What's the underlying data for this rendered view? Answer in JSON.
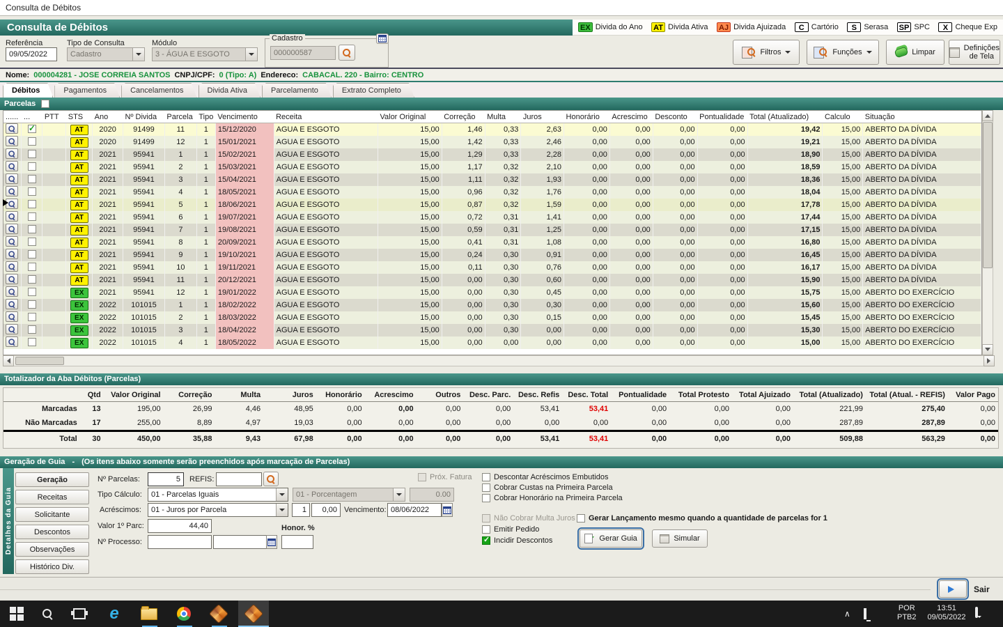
{
  "window": {
    "title": "Consulta de Débitos"
  },
  "header": {
    "title": "Consulta de Débitos",
    "legend": [
      {
        "badge": "EX",
        "type": "green",
        "label": "Divida do Ano"
      },
      {
        "badge": "AT",
        "type": "yellow",
        "label": "Divida Ativa"
      },
      {
        "badge": "AJ",
        "type": "orange",
        "label": "Divida Ajuizada"
      },
      {
        "badge": "C",
        "type": "plain",
        "label": "Cartório"
      },
      {
        "badge": "S",
        "type": "plain",
        "label": "Serasa"
      },
      {
        "badge": "SP",
        "type": "plain",
        "label": "SPC"
      },
      {
        "badge": "X",
        "type": "plain",
        "label": "Cheque Exp"
      }
    ]
  },
  "filters": {
    "referencia": {
      "label": "Referência",
      "value": "09/05/2022"
    },
    "tipo_consulta": {
      "label": "Tipo de Consulta",
      "value": "Cadastro"
    },
    "modulo": {
      "label": "Módulo",
      "value": "3 - ÁGUA E ESGOTO"
    },
    "cadastro": {
      "label": "Cadastro",
      "value": "000000587"
    },
    "buttons": {
      "filtros": "Filtros",
      "funcoes": "Funções",
      "limpar": "Limpar",
      "definicoes_l1": "Definições",
      "definicoes_l2": "de Tela"
    }
  },
  "person": {
    "nome_label": "Nome:",
    "nome": "000004281 - JOSE CORREIA SANTOS",
    "cnpj_label": "CNPJ/CPF:",
    "cnpj": "0 (Tipo: A)",
    "endereco_label": "Endereco:",
    "endereco": "CABACAL. 220 - Bairro: CENTRO"
  },
  "tabs": [
    "Débitos",
    "Pagamentos",
    "Cancelamentos",
    "Divida Ativa",
    "Parcelamento",
    "Extrato Completo"
  ],
  "parcelas_label": "Parcelas",
  "debits": {
    "columns": [
      "......",
      "...",
      "PTT",
      "STS",
      "Ano",
      "Nº Divida",
      "Parcela",
      "Tipo",
      "Vencimento",
      "Receita",
      "Valor Original",
      "Correção",
      "Multa",
      "Juros",
      "Honorário",
      "Acrescimo",
      "Desconto",
      "Pontualidade",
      "Total (Atualizado)",
      "Calculo",
      "Situação"
    ],
    "checked_rows": [
      0
    ],
    "current_row": 6,
    "rows": [
      [
        "AT",
        "2020",
        "91499",
        "11",
        "1",
        "15/12/2020",
        "AGUA E ESGOTO",
        "15,00",
        "1,46",
        "0,33",
        "2,63",
        "0,00",
        "0,00",
        "0,00",
        "0,00",
        "19,42",
        "15,00",
        "ABERTO DA DÍVIDA"
      ],
      [
        "AT",
        "2020",
        "91499",
        "12",
        "1",
        "15/01/2021",
        "AGUA E ESGOTO",
        "15,00",
        "1,42",
        "0,33",
        "2,46",
        "0,00",
        "0,00",
        "0,00",
        "0,00",
        "19,21",
        "15,00",
        "ABERTO DA DÍVIDA"
      ],
      [
        "AT",
        "2021",
        "95941",
        "1",
        "1",
        "15/02/2021",
        "AGUA E ESGOTO",
        "15,00",
        "1,29",
        "0,33",
        "2,28",
        "0,00",
        "0,00",
        "0,00",
        "0,00",
        "18,90",
        "15,00",
        "ABERTO DA DÍVIDA"
      ],
      [
        "AT",
        "2021",
        "95941",
        "2",
        "1",
        "15/03/2021",
        "AGUA E ESGOTO",
        "15,00",
        "1,17",
        "0,32",
        "2,10",
        "0,00",
        "0,00",
        "0,00",
        "0,00",
        "18,59",
        "15,00",
        "ABERTO DA DÍVIDA"
      ],
      [
        "AT",
        "2021",
        "95941",
        "3",
        "1",
        "15/04/2021",
        "AGUA E ESGOTO",
        "15,00",
        "1,11",
        "0,32",
        "1,93",
        "0,00",
        "0,00",
        "0,00",
        "0,00",
        "18,36",
        "15,00",
        "ABERTO DA DÍVIDA"
      ],
      [
        "AT",
        "2021",
        "95941",
        "4",
        "1",
        "18/05/2021",
        "AGUA E ESGOTO",
        "15,00",
        "0,96",
        "0,32",
        "1,76",
        "0,00",
        "0,00",
        "0,00",
        "0,00",
        "18,04",
        "15,00",
        "ABERTO DA DÍVIDA"
      ],
      [
        "AT",
        "2021",
        "95941",
        "5",
        "1",
        "18/06/2021",
        "AGUA E ESGOTO",
        "15,00",
        "0,87",
        "0,32",
        "1,59",
        "0,00",
        "0,00",
        "0,00",
        "0,00",
        "17,78",
        "15,00",
        "ABERTO DA DÍVIDA"
      ],
      [
        "AT",
        "2021",
        "95941",
        "6",
        "1",
        "19/07/2021",
        "AGUA E ESGOTO",
        "15,00",
        "0,72",
        "0,31",
        "1,41",
        "0,00",
        "0,00",
        "0,00",
        "0,00",
        "17,44",
        "15,00",
        "ABERTO DA DÍVIDA"
      ],
      [
        "AT",
        "2021",
        "95941",
        "7",
        "1",
        "19/08/2021",
        "AGUA E ESGOTO",
        "15,00",
        "0,59",
        "0,31",
        "1,25",
        "0,00",
        "0,00",
        "0,00",
        "0,00",
        "17,15",
        "15,00",
        "ABERTO DA DÍVIDA"
      ],
      [
        "AT",
        "2021",
        "95941",
        "8",
        "1",
        "20/09/2021",
        "AGUA E ESGOTO",
        "15,00",
        "0,41",
        "0,31",
        "1,08",
        "0,00",
        "0,00",
        "0,00",
        "0,00",
        "16,80",
        "15,00",
        "ABERTO DA DÍVIDA"
      ],
      [
        "AT",
        "2021",
        "95941",
        "9",
        "1",
        "19/10/2021",
        "AGUA E ESGOTO",
        "15,00",
        "0,24",
        "0,30",
        "0,91",
        "0,00",
        "0,00",
        "0,00",
        "0,00",
        "16,45",
        "15,00",
        "ABERTO DA DÍVIDA"
      ],
      [
        "AT",
        "2021",
        "95941",
        "10",
        "1",
        "19/11/2021",
        "AGUA E ESGOTO",
        "15,00",
        "0,11",
        "0,30",
        "0,76",
        "0,00",
        "0,00",
        "0,00",
        "0,00",
        "16,17",
        "15,00",
        "ABERTO DA DÍVIDA"
      ],
      [
        "AT",
        "2021",
        "95941",
        "11",
        "1",
        "20/12/2021",
        "AGUA E ESGOTO",
        "15,00",
        "0,00",
        "0,30",
        "0,60",
        "0,00",
        "0,00",
        "0,00",
        "0,00",
        "15,90",
        "15,00",
        "ABERTO DA DÍVIDA"
      ],
      [
        "EX",
        "2021",
        "95941",
        "12",
        "1",
        "19/01/2022",
        "AGUA E ESGOTO",
        "15,00",
        "0,00",
        "0,30",
        "0,45",
        "0,00",
        "0,00",
        "0,00",
        "0,00",
        "15,75",
        "15,00",
        "ABERTO DO EXERCÍCIO"
      ],
      [
        "EX",
        "2022",
        "101015",
        "1",
        "1",
        "18/02/2022",
        "AGUA E ESGOTO",
        "15,00",
        "0,00",
        "0,30",
        "0,30",
        "0,00",
        "0,00",
        "0,00",
        "0,00",
        "15,60",
        "15,00",
        "ABERTO DO EXERCÍCIO"
      ],
      [
        "EX",
        "2022",
        "101015",
        "2",
        "1",
        "18/03/2022",
        "AGUA E ESGOTO",
        "15,00",
        "0,00",
        "0,30",
        "0,15",
        "0,00",
        "0,00",
        "0,00",
        "0,00",
        "15,45",
        "15,00",
        "ABERTO DO EXERCÍCIO"
      ],
      [
        "EX",
        "2022",
        "101015",
        "3",
        "1",
        "18/04/2022",
        "AGUA E ESGOTO",
        "15,00",
        "0,00",
        "0,30",
        "0,00",
        "0,00",
        "0,00",
        "0,00",
        "0,00",
        "15,30",
        "15,00",
        "ABERTO DO EXERCÍCIO"
      ],
      [
        "EX",
        "2022",
        "101015",
        "4",
        "1",
        "18/05/2022",
        "AGUA E ESGOTO",
        "15,00",
        "0,00",
        "0,00",
        "0,00",
        "0,00",
        "0,00",
        "0,00",
        "0,00",
        "15,00",
        "15,00",
        "ABERTO DO EXERCÍCIO"
      ]
    ]
  },
  "totals": {
    "title": "Totalizador da Aba Débitos (Parcelas)",
    "columns": [
      "",
      "Qtd",
      "Valor Original",
      "Correção",
      "Multa",
      "Juros",
      "Honorário",
      "Acrescimo",
      "Outros",
      "Desc. Parc.",
      "Desc. Refis",
      "Desc. Total",
      "Pontualidade",
      "Total Protesto",
      "Total Ajuizado",
      "Total (Atualizado)",
      "Total (Atual. - REFIS)",
      "Valor Pago"
    ],
    "rows": [
      [
        "Marcadas",
        "13",
        "195,00",
        "26,99",
        "4,46",
        "48,95",
        "0,00",
        "0,00",
        "0,00",
        "0,00",
        "53,41",
        "53,41",
        "0,00",
        "0,00",
        "0,00",
        "221,99",
        "275,40",
        "0,00"
      ],
      [
        "Não Marcadas",
        "17",
        "255,00",
        "8,89",
        "4,97",
        "19,03",
        "0,00",
        "0,00",
        "0,00",
        "0,00",
        "0,00",
        "0,00",
        "0,00",
        "0,00",
        "0,00",
        "287,89",
        "287,89",
        "0,00"
      ],
      [
        "Total",
        "30",
        "450,00",
        "35,88",
        "9,43",
        "67,98",
        "0,00",
        "0,00",
        "0,00",
        "0,00",
        "53,41",
        "53,41",
        "0,00",
        "0,00",
        "0,00",
        "509,88",
        "563,29",
        "0,00"
      ]
    ]
  },
  "guia": {
    "title": "Geração de Guia",
    "separator": "-",
    "subtitle": "(Os itens abaixo somente serão preenchidos após marcação de Parcelas)",
    "side_label": "Detalhes da Guia",
    "side_buttons": [
      "Geração",
      "Receitas",
      "Solicitante",
      "Descontos",
      "Observações",
      "Histórico Div."
    ],
    "fields": {
      "n_parcelas_label": "Nº Parcelas:",
      "n_parcelas": "5",
      "refis_label": "REFIS:",
      "refis": "",
      "prox_fatura_label": "Próx. Fatura",
      "tipo_calculo_label": "Tipo Cálculo:",
      "tipo_calculo": "01 - Parcelas Iguais",
      "porcentagem": "01 - Porcentagem",
      "porcentagem_valor": "0.00",
      "acrescimos_label": "Acréscimos:",
      "acrescimos": "01 - Juros por Parcela",
      "acrescimos_qtd": "1",
      "acrescimos_valor": "0,00",
      "vencimento_label": "Vencimento:",
      "vencimento": "08/06/2022",
      "valor_parc_label": "Valor 1º Parc:",
      "valor_parc": "44,40",
      "honor_label": "Honor. %",
      "processo_label": "Nº Processo:"
    },
    "checkboxes": [
      {
        "label": "Descontar Acréscimos Embutidos",
        "checked": false,
        "disabled": false
      },
      {
        "label": "Cobrar Custas na Primeira Parcela",
        "checked": false,
        "disabled": false
      },
      {
        "label": "Cobrar Honorário na Primeira Parcela",
        "checked": false,
        "disabled": false
      },
      {
        "label": "Não Cobrar Multa Juros",
        "checked": false,
        "disabled": true
      },
      {
        "label": "Gerar Lançamento mesmo quando a quantidade de parcelas for 1",
        "checked": false,
        "disabled": false
      },
      {
        "label": "Emitir Pedido",
        "checked": false,
        "disabled": false
      },
      {
        "label": "Incidir Descontos",
        "checked": true,
        "disabled": false
      }
    ],
    "buttons": {
      "gerar": "Gerar Guia",
      "simular": "Simular"
    }
  },
  "footer": {
    "sair": "Sair"
  },
  "taskbar": {
    "lang_line1": "POR",
    "lang_line2": "PTB2",
    "time": "13:51",
    "date": "09/05/2022"
  }
}
